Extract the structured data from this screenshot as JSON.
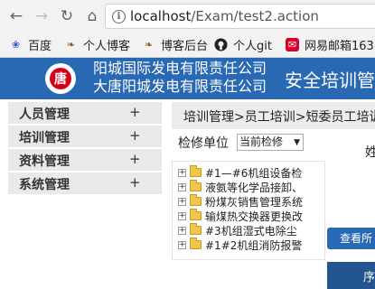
{
  "browser": {
    "url_host": "localhost",
    "url_path": "/Exam/test2.action",
    "bookmarks": [
      {
        "label": "百度",
        "icon": "paw-icon"
      },
      {
        "label": "个人博客",
        "icon": "scroll-icon"
      },
      {
        "label": "博客后台",
        "icon": "scroll-icon"
      },
      {
        "label": "个人git",
        "icon": "github-icon"
      },
      {
        "label": "网易邮箱163",
        "icon": "mail-icon"
      }
    ]
  },
  "header": {
    "company_line1": "阳城国际发电有限责任公司",
    "company_line2": "大唐阳城发电有限责任公司",
    "title": "安全培训管",
    "logo_glyph": "唐",
    "brand_color": "#2968b3",
    "logo_color": "#d4001b"
  },
  "sidebar": {
    "items": [
      {
        "label": "人员管理",
        "toggle": "+"
      },
      {
        "label": "培训管理",
        "toggle": "+"
      },
      {
        "label": "资料管理",
        "toggle": "+"
      },
      {
        "label": "系统管理",
        "toggle": "+"
      }
    ]
  },
  "main": {
    "breadcrumb": "培训管理>员工培训>短委员工培训",
    "filter_label": "检修单位",
    "filter_value": "当前检修",
    "cut_text": "姓",
    "tree": [
      "#1—#6机组设备检",
      "液氨等化学品接卸、",
      "粉煤灰销售管理系统",
      "输煤热交换器更换改",
      "#3机组湿式电除尘",
      "#1#2机组消防报警"
    ],
    "view_button": "查看所",
    "table_header": "序"
  }
}
